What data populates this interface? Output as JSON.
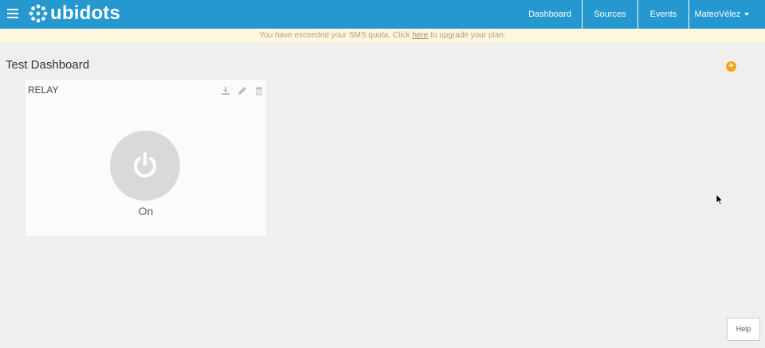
{
  "header": {
    "logo_text": "ubidots",
    "nav": {
      "dashboard": "Dashboard",
      "sources": "Sources",
      "events": "Events",
      "user": "MateoVélez"
    },
    "colors": {
      "bar": "#2599cf"
    }
  },
  "notice": {
    "before": "You have exceeded your SMS quota. Click ",
    "link": "here",
    "after": " to upgrade your plan."
  },
  "dashboard": {
    "title": "Test Dashboard",
    "add_icon": "plus-circle-icon"
  },
  "widget": {
    "title": "RELAY",
    "actions": [
      "download-icon",
      "pencil-icon",
      "trash-icon"
    ],
    "switch_icon": "power-icon",
    "state_label": "On"
  },
  "help": {
    "label": "Help"
  }
}
